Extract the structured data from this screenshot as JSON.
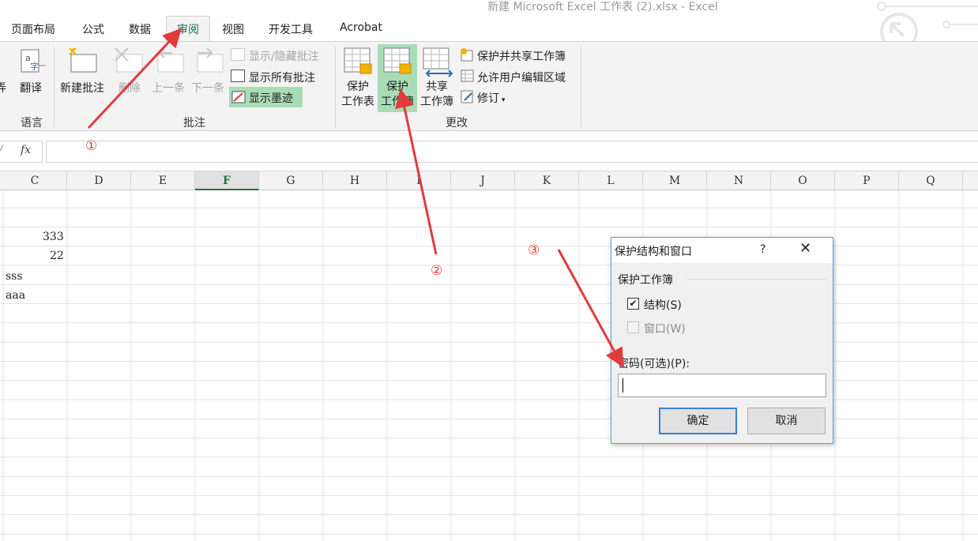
{
  "window": {
    "title": "新建 Microsoft Excel 工作表 (2).xlsx - Excel"
  },
  "tabs": [
    {
      "label": "页面布局"
    },
    {
      "label": "公式"
    },
    {
      "label": "数据"
    },
    {
      "label": "审阅",
      "active": true
    },
    {
      "label": "视图"
    },
    {
      "label": "开发工具"
    },
    {
      "label": "Acrobat"
    }
  ],
  "ribbon": {
    "language_group": {
      "partial_label": "弄",
      "translate": "翻译",
      "group_label": "语言"
    },
    "comments_group": {
      "new_comment": "新建批注",
      "delete": "删除",
      "previous": "上一条",
      "next": "下一条",
      "show_hide": "显示/隐藏批注",
      "show_all": "显示所有批注",
      "show_ink": "显示墨迹",
      "group_label": "批注"
    },
    "changes_group": {
      "protect_sheet_1": "保护",
      "protect_sheet_2": "工作表",
      "protect_workbook_1": "保护",
      "protect_workbook_2": "工作簿",
      "share_workbook_1": "共享",
      "share_workbook_2": "工作簿",
      "protect_share": "保护并共享工作簿",
      "allow_edit_ranges": "允许用户编辑区域",
      "track_changes": "修订",
      "group_label": "更改"
    }
  },
  "formula_bar": {
    "fx": "fx",
    "value": ""
  },
  "columns": [
    "C",
    "D",
    "E",
    "F",
    "G",
    "H",
    "I",
    "J",
    "K",
    "L",
    "M",
    "N",
    "O",
    "P",
    "Q"
  ],
  "selected_column": "F",
  "cells": {
    "c1": "333",
    "c2": "22",
    "b3": "sss",
    "b4": "aaa"
  },
  "dialog": {
    "title": "保护结构和窗口",
    "help": "?",
    "close": "✕",
    "group_title": "保护工作簿",
    "structure": {
      "label": "结构(S)",
      "checked": true
    },
    "windows": {
      "label": "窗口(W)",
      "checked": false,
      "disabled": true
    },
    "password_label": "密码(可选)(P):",
    "password_value": "",
    "ok": "确定",
    "cancel": "取消"
  },
  "annotations": {
    "step1": "①",
    "step2": "②",
    "step3": "③",
    "color": "#e23b3b"
  }
}
